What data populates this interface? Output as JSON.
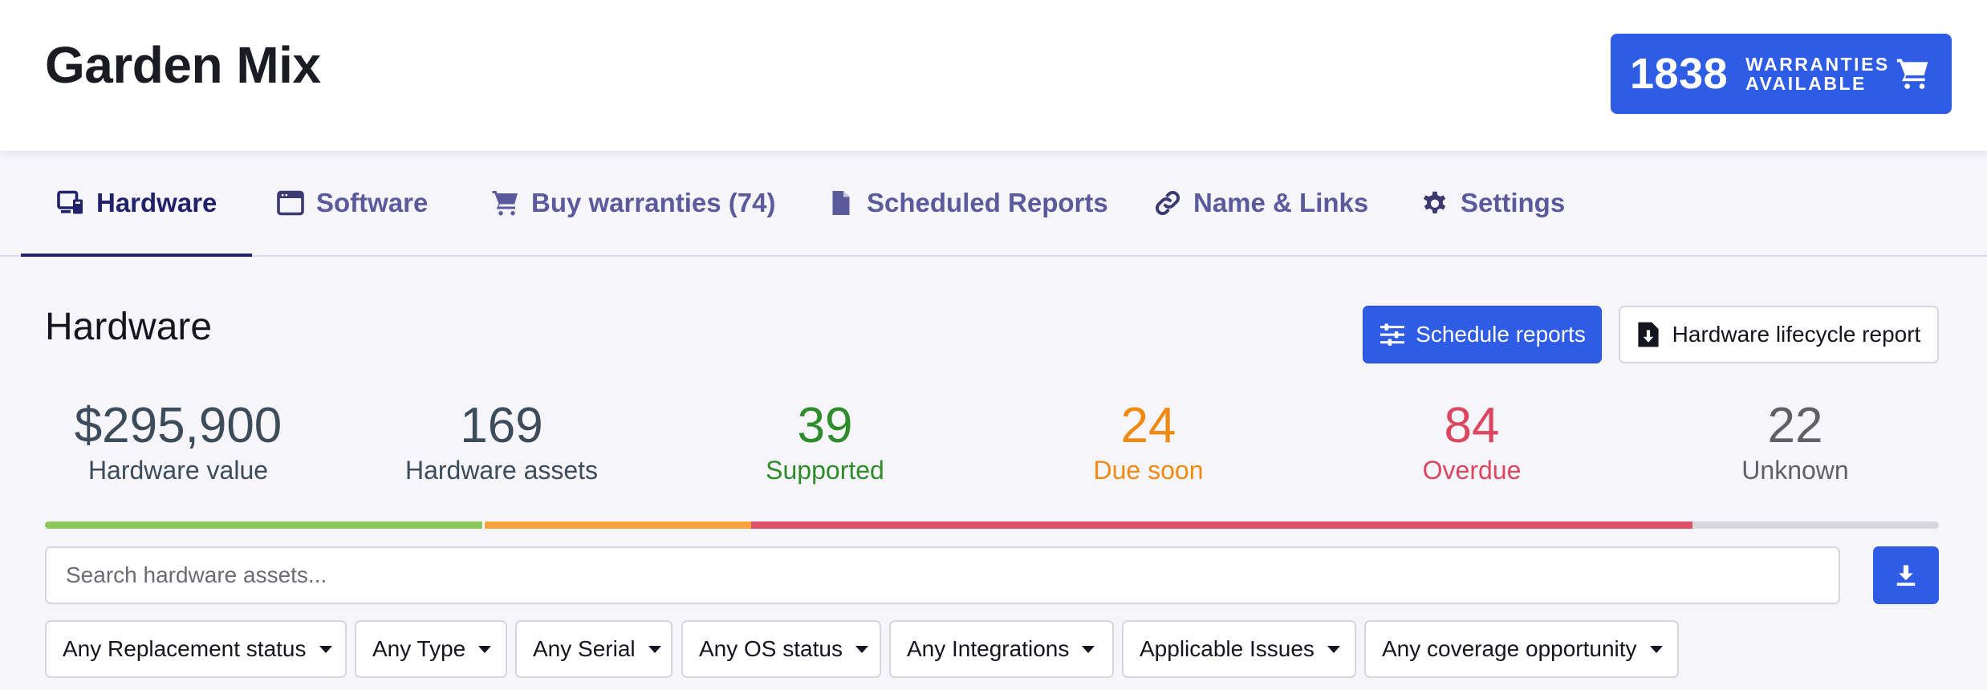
{
  "header": {
    "title": "Garden Mix",
    "warranties": {
      "count": "1838",
      "label": "WARRANTIES AVAILABLE",
      "icon": "cart-icon"
    }
  },
  "tabs": [
    {
      "label": "Hardware",
      "icon": "hardware-icon",
      "active": true
    },
    {
      "label": "Software",
      "icon": "window-icon"
    },
    {
      "label": "Buy warranties (74)",
      "icon": "cart-icon"
    },
    {
      "label": "Scheduled Reports",
      "icon": "document-icon"
    },
    {
      "label": "Name & Links",
      "icon": "link-icon"
    },
    {
      "label": "Settings",
      "icon": "gear-icon"
    }
  ],
  "section": {
    "title": "Hardware",
    "schedule_label": "Schedule reports",
    "lifecycle_label": "Hardware lifecycle report"
  },
  "stats": [
    {
      "value": "$295,900",
      "label": "Hardware value",
      "color": "#3d4c5a"
    },
    {
      "value": "169",
      "label": "Hardware assets",
      "color": "#3d4c5a"
    },
    {
      "value": "39",
      "label": "Supported",
      "color": "#2e8c2a"
    },
    {
      "value": "24",
      "label": "Due soon",
      "color": "#f08a12"
    },
    {
      "value": "84",
      "label": "Overdue",
      "color": "#dc4660"
    },
    {
      "value": "22",
      "label": "Unknown",
      "color": "#606066"
    }
  ],
  "coverage_bar": {
    "supported": 39,
    "due_soon": 24,
    "overdue": 84,
    "unknown": 22
  },
  "search": {
    "placeholder": "Search hardware assets...",
    "value": ""
  },
  "filters": [
    "Any Replacement status",
    "Any Type",
    "Any Serial",
    "Any OS status",
    "Any Integrations",
    "Applicable Issues",
    "Any coverage opportunity"
  ]
}
